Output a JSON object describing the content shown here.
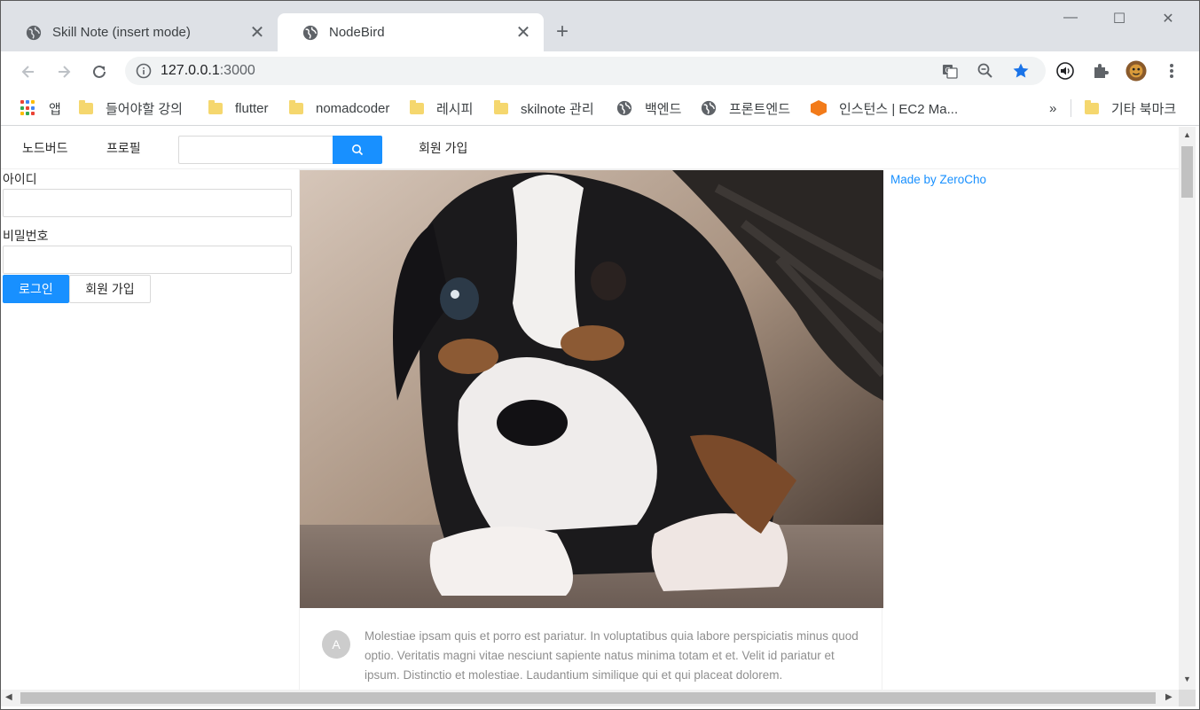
{
  "browser": {
    "tabs": [
      {
        "title": "Skill Note (insert mode)",
        "close": "✕"
      },
      {
        "title": "NodeBird",
        "close": "✕"
      }
    ],
    "new_tab": "+",
    "window_controls": {
      "minimize": "—",
      "maximize": "☐",
      "close": "✕"
    },
    "url_host": "127.0.0.1",
    "url_port": ":3000",
    "bookmarks": [
      {
        "label": "앱",
        "icon": "apps-icon"
      },
      {
        "label": "들어야할 강의",
        "icon": "folder-icon"
      },
      {
        "label": "flutter",
        "icon": "folder-icon"
      },
      {
        "label": "nomadcoder",
        "icon": "folder-icon"
      },
      {
        "label": "레시피",
        "icon": "folder-icon"
      },
      {
        "label": "skilnote 관리",
        "icon": "folder-icon"
      },
      {
        "label": "백엔드",
        "icon": "globe-icon"
      },
      {
        "label": "프론트엔드",
        "icon": "globe-icon"
      },
      {
        "label": "인스턴스 | EC2 Ma...",
        "icon": "aws-icon"
      }
    ],
    "bookmarks_more": "»",
    "other_bookmarks": "기타 북마크"
  },
  "menu": {
    "home": "노드버드",
    "profile": "프로필",
    "signup": "회원 가입"
  },
  "login": {
    "id_label": "아이디",
    "password_label": "비밀번호",
    "login_button": "로그인",
    "signup_button": "회원 가입"
  },
  "post": {
    "avatar_letter": "A",
    "content": "Molestiae ipsam quis et porro est pariatur. In voluptatibus quia labore perspiciatis minus quod optio. Veritatis magni vitae nesciunt sapiente natus minima totam et et. Velit id pariatur et ipsum. Distinctio et molestiae. Laudantium similique qui et qui placeat dolorem."
  },
  "footer": {
    "made_by": "Made by ZeroCho"
  },
  "colors": {
    "primary": "#1890ff",
    "tab_strip": "#dee1e6",
    "bookmark_star": "#1a73e8"
  }
}
